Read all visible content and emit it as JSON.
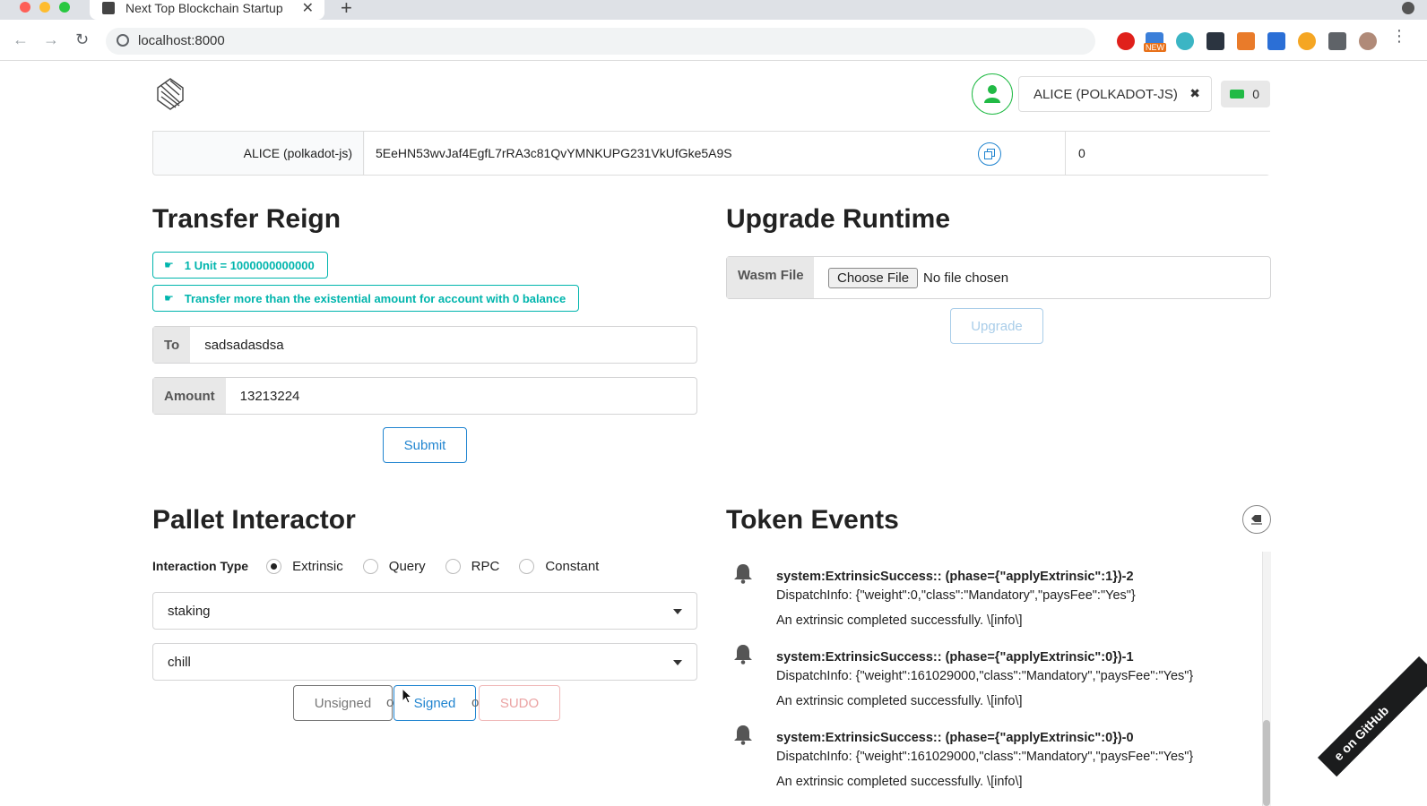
{
  "browser": {
    "tab_title": "Next Top Blockchain Startup",
    "tab_close": "✕",
    "new_tab": "+",
    "url": "localhost:8000",
    "ext_new_badge": "NEW"
  },
  "header": {
    "account_name": "ALICE (POLKADOT-JS)",
    "account_clear": "✖",
    "balance": "0"
  },
  "account_table": {
    "name": "ALICE (polkadot-js)",
    "address": "5EeHN53wvJaf4EgfL7rRA3c81QvYMNKUPG231VkUfGke5A9S",
    "balance": "0"
  },
  "transfer": {
    "heading": "Transfer Reign",
    "notice_unit": "1 Unit = 1000000000000",
    "notice_existential": "Transfer more than the existential amount for account with 0 balance",
    "to_label": "To",
    "to_value": "sadsadasdsa",
    "amount_label": "Amount",
    "amount_value": "13213224",
    "submit_label": "Submit"
  },
  "upgrade": {
    "heading": "Upgrade Runtime",
    "wasm_label": "Wasm File",
    "choose_file_label": "Choose File",
    "no_file_text": "No file chosen",
    "upgrade_label": "Upgrade"
  },
  "pallet": {
    "heading": "Pallet Interactor",
    "interaction_type_label": "Interaction Type",
    "types": [
      "Extrinsic",
      "Query",
      "RPC",
      "Constant"
    ],
    "selected_type": "Extrinsic",
    "pallet_value": "staking",
    "callable_value": "chill",
    "unsigned_label": "Unsigned",
    "signed_label": "Signed",
    "sudo_label": "SUDO",
    "or_text": "or"
  },
  "events": {
    "heading": "Token Events",
    "items": [
      {
        "title": "system:ExtrinsicSuccess:: (phase={\"applyExtrinsic\":1})-2",
        "info": "DispatchInfo: {\"weight\":0,\"class\":\"Mandatory\",\"paysFee\":\"Yes\"}",
        "desc": "An extrinsic completed successfully. \\[info\\]"
      },
      {
        "title": "system:ExtrinsicSuccess:: (phase={\"applyExtrinsic\":0})-1",
        "info": "DispatchInfo: {\"weight\":161029000,\"class\":\"Mandatory\",\"paysFee\":\"Yes\"}",
        "desc": "An extrinsic completed successfully. \\[info\\]"
      },
      {
        "title": "system:ExtrinsicSuccess:: (phase={\"applyExtrinsic\":0})-0",
        "info": "DispatchInfo: {\"weight\":161029000,\"class\":\"Mandatory\",\"paysFee\":\"Yes\"}",
        "desc": "An extrinsic completed successfully. \\[info\\]"
      }
    ]
  },
  "ribbon_text": "e on GitHub",
  "colors": {
    "teal": "#00b5ad",
    "blue": "#2185d0",
    "green": "#21ba45",
    "red_sudo": "#db2828"
  }
}
